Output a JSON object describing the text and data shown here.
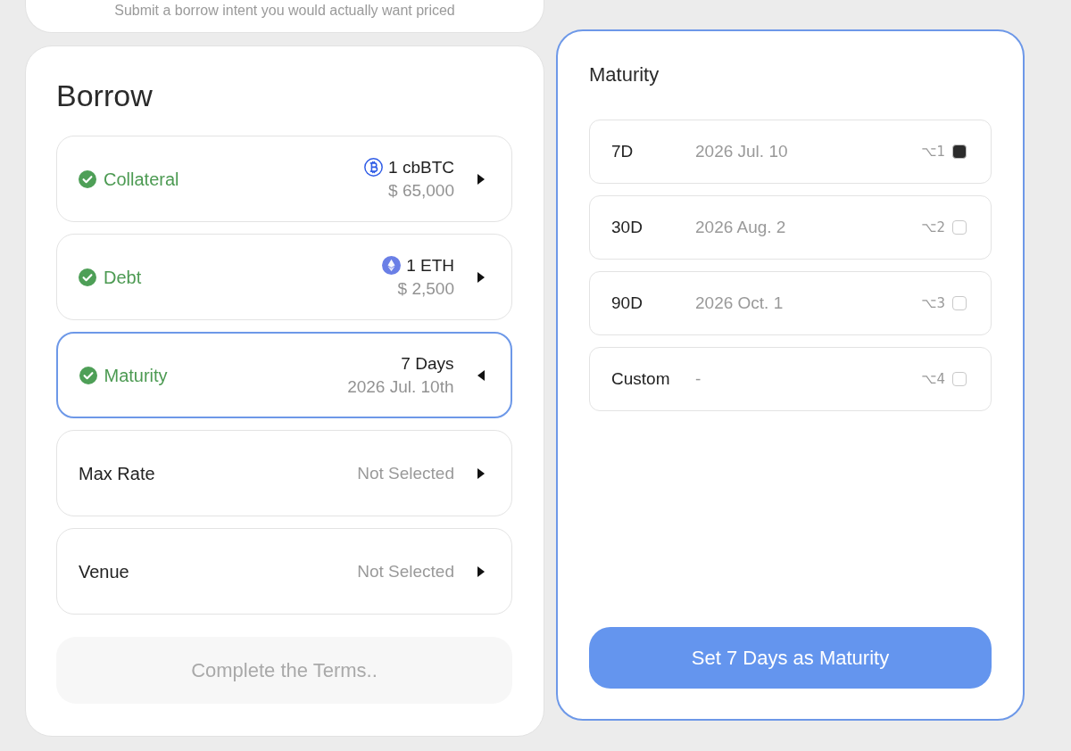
{
  "intro_card": {
    "text": "Submit a borrow intent you would actually want priced"
  },
  "borrow_panel": {
    "title": "Borrow",
    "terms": [
      {
        "label": "Collateral",
        "kind": "bitcoin",
        "complete": true,
        "expanded": false,
        "value": "1 cbBTC",
        "subvalue": "$ 65,000"
      },
      {
        "label": "Debt",
        "kind": "ether",
        "complete": true,
        "expanded": false,
        "value": "1 ETH",
        "subvalue": "$ 2,500"
      },
      {
        "label": "Maturity",
        "kind": "date",
        "complete": true,
        "expanded": true,
        "value": "7 Days",
        "subvalue": "2026 Jul. 10th"
      },
      {
        "label": "Max Rate",
        "kind": "unset",
        "complete": false,
        "expanded": false,
        "value": "Not Selected"
      },
      {
        "label": "Venue",
        "kind": "unset",
        "complete": false,
        "expanded": false,
        "value": "Not Selected"
      }
    ],
    "submit_button": {
      "label": "Complete the Terms..",
      "disabled": true
    }
  },
  "maturity_panel": {
    "title": "Maturity",
    "options": [
      {
        "label": "7D",
        "date": "2026 Jul. 10",
        "shortcut": "⌥1",
        "checked": true
      },
      {
        "label": "30D",
        "date": "2026 Aug. 2",
        "shortcut": "⌥2",
        "checked": false
      },
      {
        "label": "90D",
        "date": "2026 Oct. 1",
        "shortcut": "⌥3",
        "checked": false
      },
      {
        "label": "Custom",
        "date": "-",
        "shortcut": "⌥4",
        "checked": false
      }
    ],
    "confirm_button": {
      "label": "Set 7 Days as Maturity",
      "disabled": false
    }
  }
}
